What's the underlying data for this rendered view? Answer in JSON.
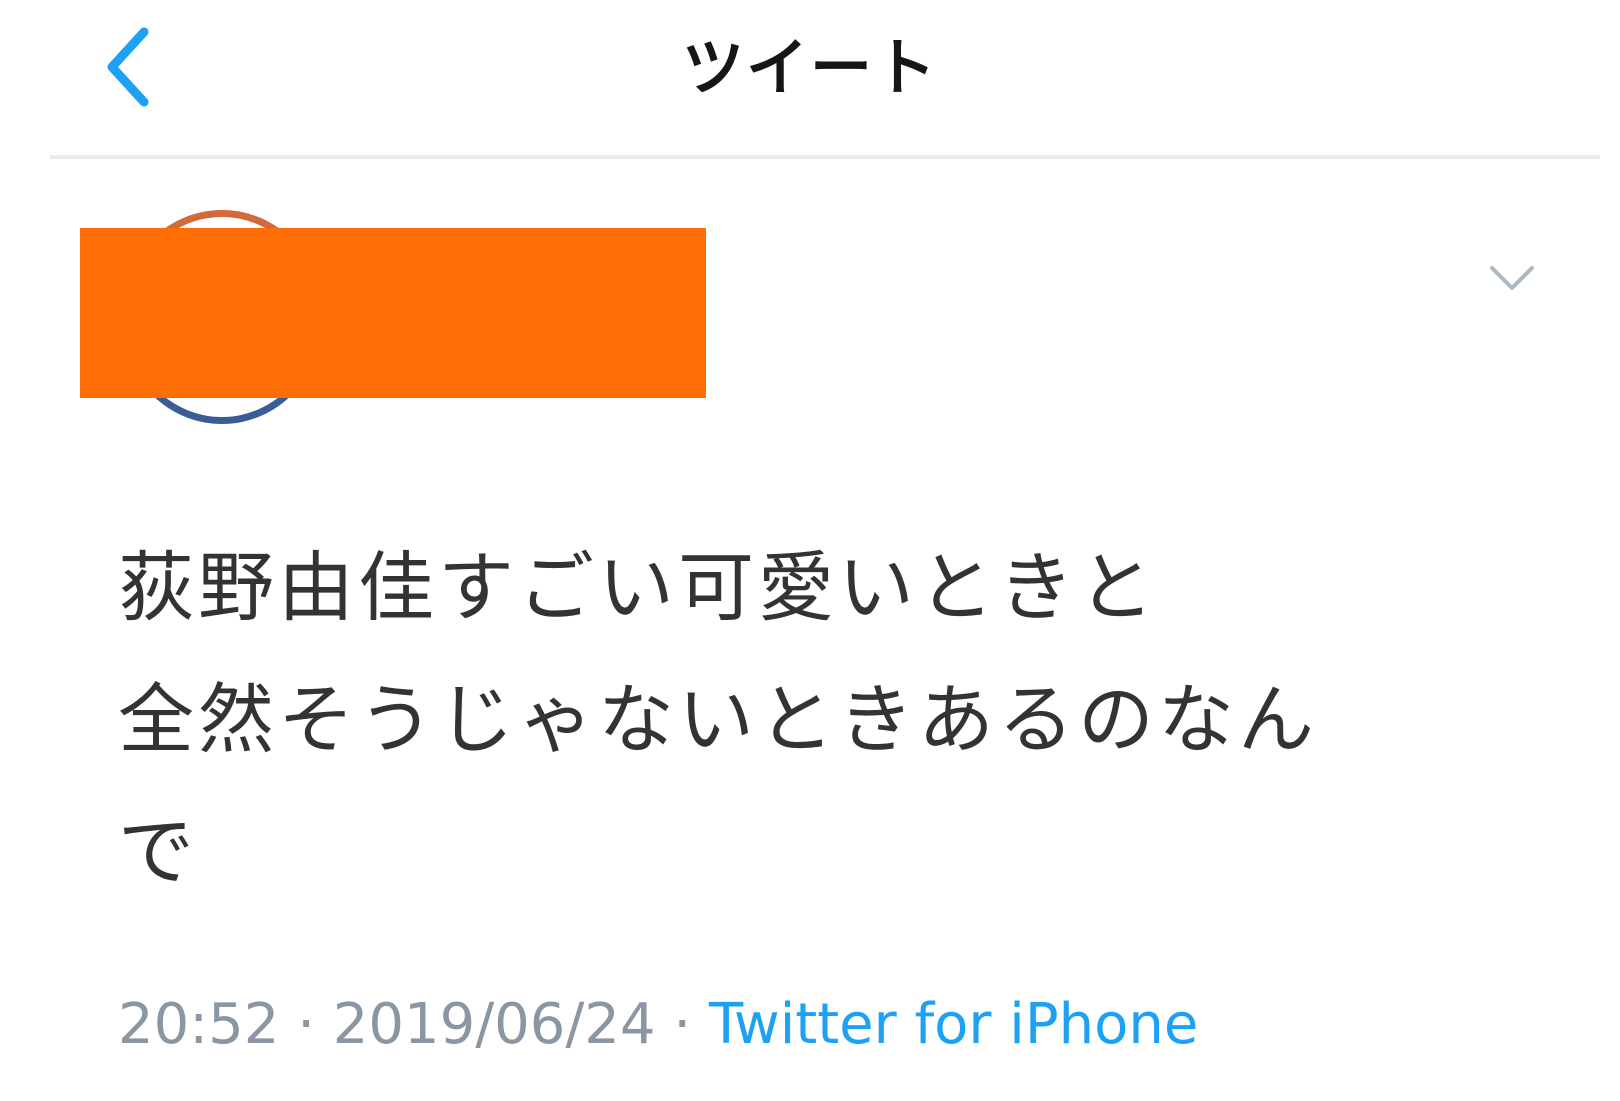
{
  "nav": {
    "title": "ツイート",
    "back_icon": "chevron-left-icon"
  },
  "colors": {
    "accent": "#1da1f2",
    "redaction": "#ff6e04",
    "muted_text": "#8a96a3",
    "body_text": "#333333"
  },
  "author": {
    "avatar_icon": "avatar",
    "menu_icon": "chevron-down-icon"
  },
  "tweet": {
    "text": "荻野由佳すごい可愛いときと\n全然そうじゃないときあるのなん\nで",
    "time": "20:52",
    "separator": " · ",
    "date": "2019/06/24",
    "source": "Twitter for iPhone"
  }
}
